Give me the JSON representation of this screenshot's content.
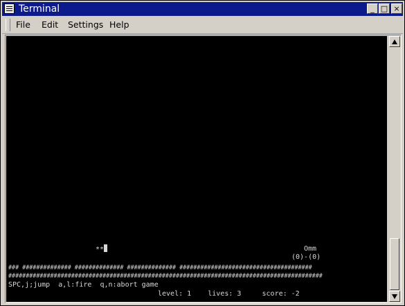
{
  "window": {
    "title": "Terminal",
    "controls": {
      "minimize": "_",
      "maximize": "□",
      "close": "×"
    }
  },
  "menubar": {
    "items": [
      {
        "label": "File"
      },
      {
        "label": "Edit"
      },
      {
        "label": "Settings"
      },
      {
        "label": "Help"
      }
    ]
  },
  "terminal": {
    "player": "**",
    "enemy_name": "Omm",
    "enemy_sprite": "(0)-(0)",
    "ground_row_1": "### ############## ############## ############## ######################################",
    "ground_row_2": "##########################################################################################",
    "help_text": "SPC,j;jump  a,l:fire  q,n:abort game",
    "status_text": "level: 1    lives: 3     score: -2"
  },
  "colors": {
    "titlebar": "#0d1a8c",
    "terminal_bg": "#000000",
    "terminal_fg": "#d8d8d8",
    "chrome": "#d4d0c8"
  }
}
